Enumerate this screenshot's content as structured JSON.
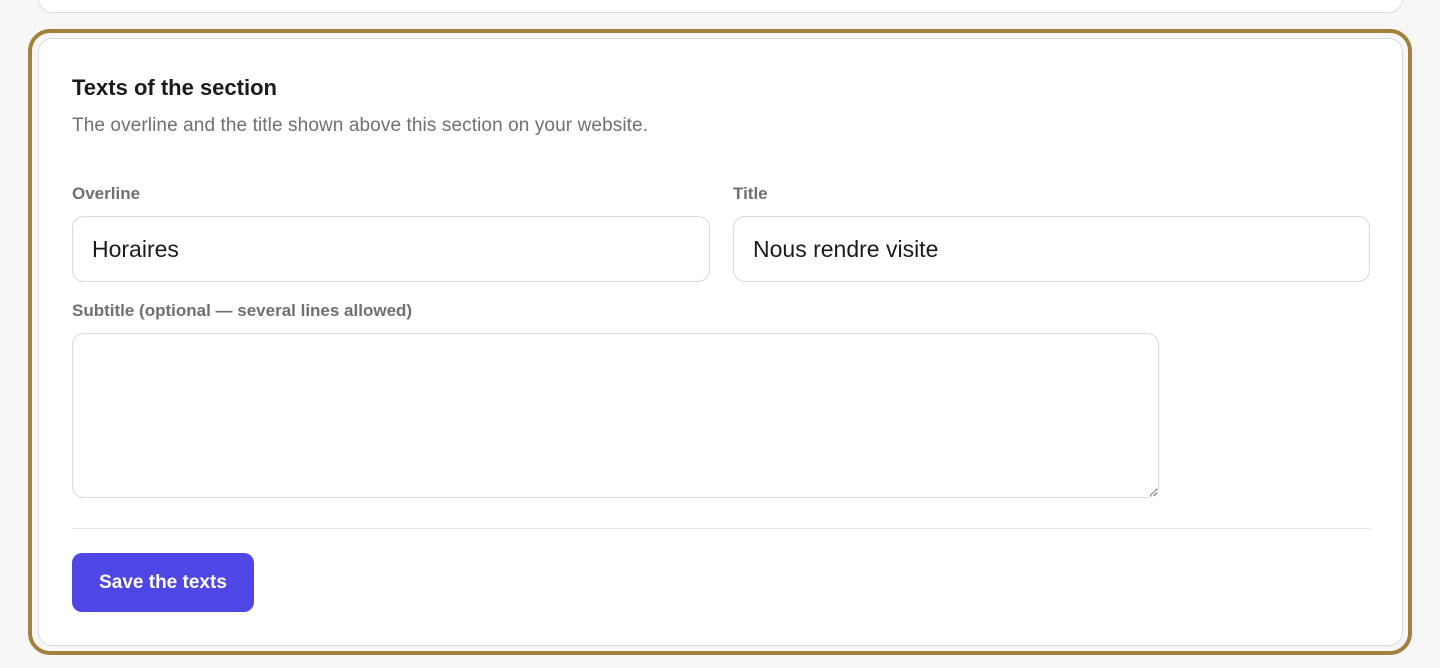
{
  "section": {
    "title": "Texts of the section",
    "description": "The overline and the title shown above this section on your website."
  },
  "fields": {
    "overline": {
      "label": "Overline",
      "value": "Horaires"
    },
    "title": {
      "label": "Title",
      "value": "Nous rendre visite"
    },
    "subtitle": {
      "label": "Subtitle (optional — several lines allowed)",
      "value": ""
    }
  },
  "actions": {
    "save_label": "Save the texts"
  },
  "colors": {
    "accent": "#4f46e5",
    "highlight_ring": "#a3803c",
    "muted_text": "#6f6f76",
    "border": "#d9d9de"
  }
}
